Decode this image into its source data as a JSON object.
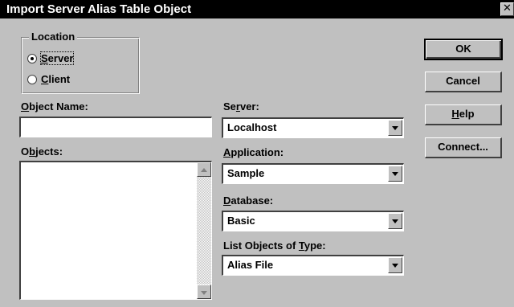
{
  "window": {
    "title": "Import Server Alias Table Object",
    "close_glyph": "✕"
  },
  "location": {
    "legend": "Location",
    "options": [
      {
        "label": "Server",
        "mnemonic": "S",
        "rest": "erver",
        "selected": true
      },
      {
        "label": "Client",
        "mnemonic": "C",
        "rest": "lient",
        "selected": false
      }
    ]
  },
  "object_name": {
    "label": "Object Name:",
    "mnemonic": "O",
    "rest": "bject Name:",
    "value": ""
  },
  "objects": {
    "label": "Objects:",
    "pre": "O",
    "mnemonic": "b",
    "rest": "jects:",
    "items": []
  },
  "server": {
    "label": "Server:",
    "pre": "Se",
    "mnemonic": "r",
    "rest": "ver:",
    "value": "Localhost"
  },
  "application": {
    "label": "Application:",
    "mnemonic": "A",
    "rest": "pplication:",
    "value": "Sample"
  },
  "database": {
    "label": "Database:",
    "mnemonic": "D",
    "rest": "atabase:",
    "value": "Basic"
  },
  "list_type": {
    "label": "List Objects of Type:",
    "pre": "List Objects of ",
    "mnemonic": "T",
    "rest": "ype:",
    "value": "Alias File"
  },
  "buttons": {
    "ok": "OK",
    "cancel": "Cancel",
    "help_mnemonic": "H",
    "help_rest": "elp",
    "connect": "Connect..."
  },
  "colors": {
    "face": "#c0c0c0",
    "titlebar": "#000000",
    "field": "#ffffff"
  }
}
